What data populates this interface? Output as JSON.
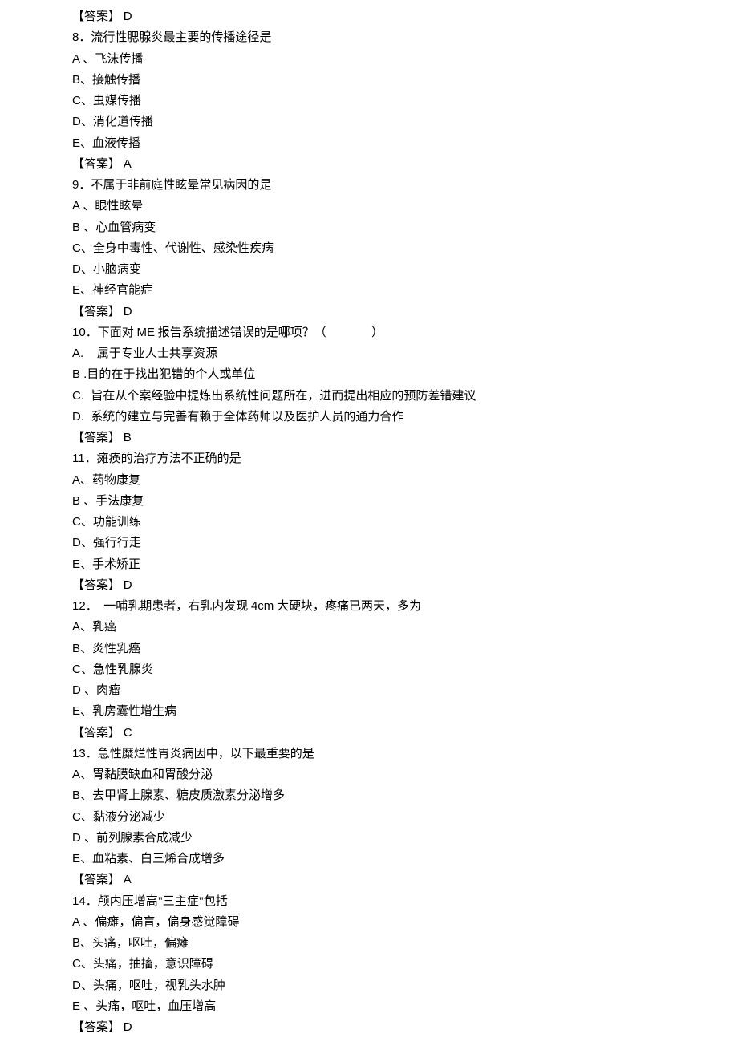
{
  "prev_answer": {
    "label": "【答案】",
    "value": "D"
  },
  "q8": {
    "num": "8",
    "stem": "．流行性腮腺炎最主要的传播途径是",
    "opts": {
      "A": "、飞沫传播",
      "B": "、接触传播",
      "C": "、虫媒传播",
      "D": "、消化道传播",
      "E": "、血液传播"
    },
    "answer": {
      "label": "【答案】",
      "value": "A"
    }
  },
  "q9": {
    "num": "9",
    "stem": "．不属于非前庭性眩晕常见病因的是",
    "opts": {
      "A": "、眼性眩晕",
      "B": "、心血管病变",
      "C": "、全身中毒性、代谢性、感染性疾病",
      "D": "、小脑病变",
      "E": "、神经官能症"
    },
    "answer": {
      "label": "【答案】",
      "value": "D"
    }
  },
  "q10": {
    "num": "10",
    "stem_before": "．下面对 ",
    "stem_mid": "ME",
    "stem_after": " 报告系统描述错误的是哪项？（               ）",
    "opts": {
      "A": "属于专业人士共享资源",
      "B": "目的在于找出犯错的个人或单位",
      "C": "旨在从个案经验中提炼出系统性问题所在，进而提出相应的预防差错建议",
      "D": "系统的建立与完善有赖于全体药师以及医护人员的通力合作"
    },
    "answer": {
      "label": "【答案】",
      "value": "B"
    }
  },
  "q11": {
    "num": "11",
    "stem": "．瘫痪的治疗方法不正确的是",
    "opts": {
      "A": "、药物康复",
      "B": "、手法康复",
      "C": "、功能训练",
      "D": "、强行行走",
      "E": "、手术矫正"
    },
    "answer": {
      "label": "【答案】",
      "value": "D"
    }
  },
  "q12": {
    "num": "12",
    "stem_before": "．  一哺乳期患者，右乳内发现 ",
    "stem_mid": "4cm",
    "stem_after": " 大硬块，疼痛已两天，多为",
    "opts": {
      "A": "、乳癌",
      "B": "、炎性乳癌",
      "C": "、急性乳腺炎",
      "D": "、肉瘤",
      "E": "、乳房囊性增生病"
    },
    "answer": {
      "label": "【答案】",
      "value": "C"
    }
  },
  "q13": {
    "num": "13",
    "stem": "．急性糜烂性胃炎病因中，以下最重要的是",
    "opts": {
      "A": "、胃黏膜缺血和胃酸分泌",
      "B": "、去甲肾上腺素、糖皮质激素分泌增多",
      "C": "、黏液分泌减少",
      "D": "、前列腺素合成减少",
      "E": "、血粘素、白三烯合成增多"
    },
    "answer": {
      "label": "【答案】",
      "value": "A"
    }
  },
  "q14": {
    "num": "14",
    "stem": "．颅内压增高\"三主症\"包括",
    "opts": {
      "A": "、偏瘫，偏盲，偏身感觉障碍",
      "B": "、头痛，呕吐，偏瘫",
      "C": "、头痛，抽搐，意识障碍",
      "D": "、头痛，呕吐，视乳头水肿",
      "E": "、头痛，呕吐，血压增高"
    },
    "answer": {
      "label": "【答案】",
      "value": "D"
    }
  }
}
